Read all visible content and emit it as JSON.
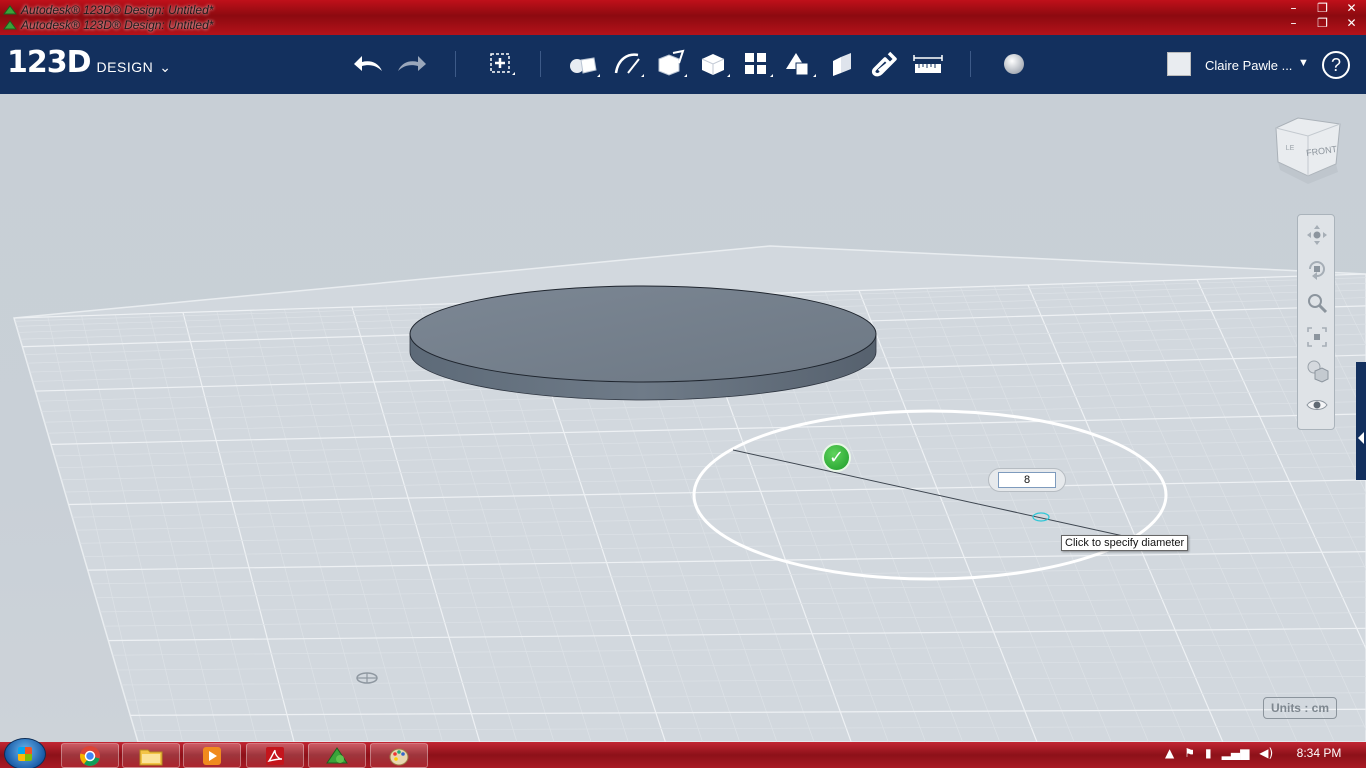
{
  "window": {
    "title_1": "Autodesk® 123D® Design: Untitled*",
    "title_2": "Autodesk® 123D® Design: Untitled*",
    "minimize": "–",
    "restore": "❐",
    "close": "✕"
  },
  "appbar": {
    "logo_number": "123D",
    "logo_text": "DESIGN",
    "logo_caret": "⌄",
    "tools": [
      {
        "name": "undo-icon"
      },
      {
        "name": "redo-icon"
      },
      {
        "name": "transform-icon"
      },
      {
        "name": "primitives-icon"
      },
      {
        "name": "sketch-icon"
      },
      {
        "name": "construct-icon"
      },
      {
        "name": "modify-icon"
      },
      {
        "name": "pattern-icon"
      },
      {
        "name": "grouping-icon"
      },
      {
        "name": "combine-icon"
      },
      {
        "name": "snap-icon"
      },
      {
        "name": "measure-icon"
      },
      {
        "name": "material-icon"
      }
    ],
    "user_name": "Claire Pawle ...",
    "user_caret": "▼",
    "help": "?"
  },
  "viewport": {
    "viewcube_face": "FRONT",
    "viewcube_side": "LE",
    "dimension_value": "8",
    "tooltip": "Click to specify diameter",
    "confirm_symbol": "✓",
    "units": "Units : cm",
    "nav_tools": [
      "pan-icon",
      "orbit-icon",
      "zoom-icon",
      "fit-icon",
      "view-mode-icon",
      "visibility-icon"
    ]
  },
  "taskbar": {
    "time": "8:34 PM",
    "apps": [
      "chrome-icon",
      "file-explorer-icon",
      "media-player-icon",
      "acrobat-icon",
      "123d-design-icon",
      "paint-icon"
    ]
  }
}
